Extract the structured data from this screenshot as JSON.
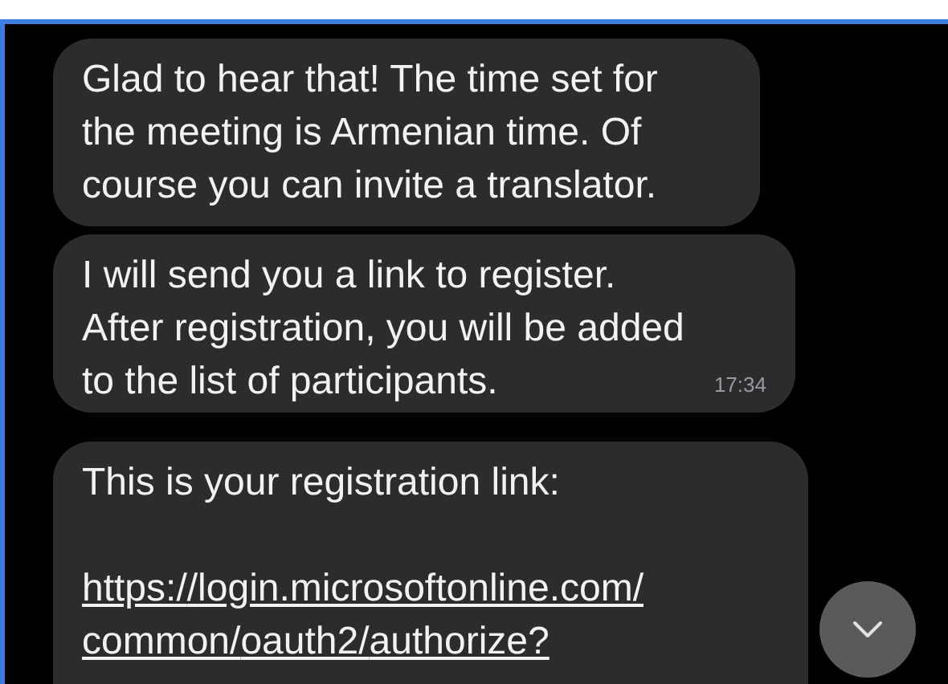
{
  "messages": [
    {
      "text": "Glad to hear that! The time set for the meeting is Armenian time. Of course you can invite a translator."
    },
    {
      "text": "I will send you a link to register. After registration, you will be added to the list of participants.",
      "time": "17:34"
    },
    {
      "text": "This is your registration link:",
      "link": "https://login.microsoftonline.com/common/oauth2/authorize?"
    }
  ]
}
